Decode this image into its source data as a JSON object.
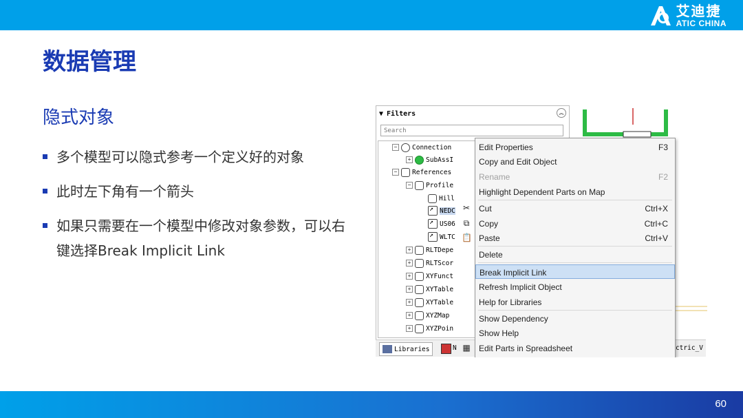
{
  "brand": {
    "cn": "艾迪捷",
    "en": "ATIC CHINA"
  },
  "page": {
    "title": "数据管理",
    "section": "隐式对象",
    "number": "60"
  },
  "bullets": [
    "多个模型可以隐式参考一个定义好的对象",
    "此时左下角有一个箭头",
    "如果只需要在一个模型中修改对象参数，可以右键选择Break Implicit Link"
  ],
  "colors": {
    "top_bar": "#00a0e9",
    "title": "#1a3bb3",
    "selection": "#cde0f5"
  },
  "filters": {
    "header": "Filters",
    "search_placeholder": "Search",
    "tree": [
      "Connection",
      "SubAssI",
      "References",
      "Profile",
      "Hill",
      "NEDC",
      "US06",
      "WLTC",
      "RLTDepe",
      "RLTScor",
      "XYFunct",
      "XYTable",
      "XYTable",
      "XYZMap",
      "XYZPoin"
    ]
  },
  "bottom_tabs": {
    "libraries": "Libraries",
    "tab2": "N",
    "right": "ectric_V"
  },
  "context_menu": [
    {
      "label": "Edit Properties",
      "shortcut": "F3"
    },
    {
      "label": "Copy and Edit Object",
      "shortcut": ""
    },
    {
      "label": "Rename",
      "shortcut": "F2"
    },
    {
      "label": "Highlight Dependent Parts on Map",
      "shortcut": ""
    },
    {
      "label": "Cut",
      "shortcut": "Ctrl+X"
    },
    {
      "label": "Copy",
      "shortcut": "Ctrl+C"
    },
    {
      "label": "Paste",
      "shortcut": "Ctrl+V"
    },
    {
      "label": "Delete",
      "shortcut": ""
    },
    {
      "label": "Break Implicit Link",
      "shortcut": ""
    },
    {
      "label": "Refresh Implicit Object",
      "shortcut": ""
    },
    {
      "label": "Help for Libraries",
      "shortcut": ""
    },
    {
      "label": "Show Dependency",
      "shortcut": ""
    },
    {
      "label": "Show Help",
      "shortcut": ""
    },
    {
      "label": "Edit Parts in Spreadsheet",
      "shortcut": ""
    }
  ]
}
